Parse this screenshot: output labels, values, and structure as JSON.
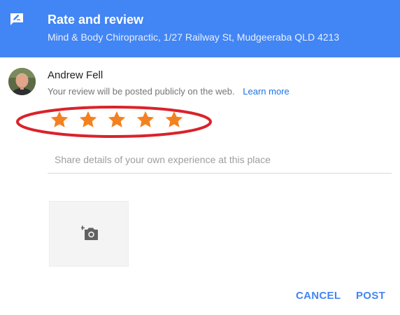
{
  "header": {
    "title": "Rate and review",
    "subtitle": "Mind & Body Chiropractic, 1/27 Railway St, Mudgeeraba QLD 4213",
    "icon": "rate-review-icon",
    "background_color": "#4285f4"
  },
  "user": {
    "name": "Andrew Fell",
    "notice": "Your review will be posted publicly on the web.",
    "learn_more": "Learn more",
    "avatar": "avatar-icon"
  },
  "rating": {
    "value": 5,
    "max": 5,
    "star_color": "#f4811f",
    "highlight": "red-ellipse-annotation",
    "highlight_color": "#d9232a"
  },
  "review": {
    "placeholder": "Share details of your own experience at this place",
    "value": ""
  },
  "photo": {
    "icon": "add-photo-icon"
  },
  "actions": {
    "cancel_label": "CANCEL",
    "post_label": "POST",
    "color": "#4285f4"
  }
}
